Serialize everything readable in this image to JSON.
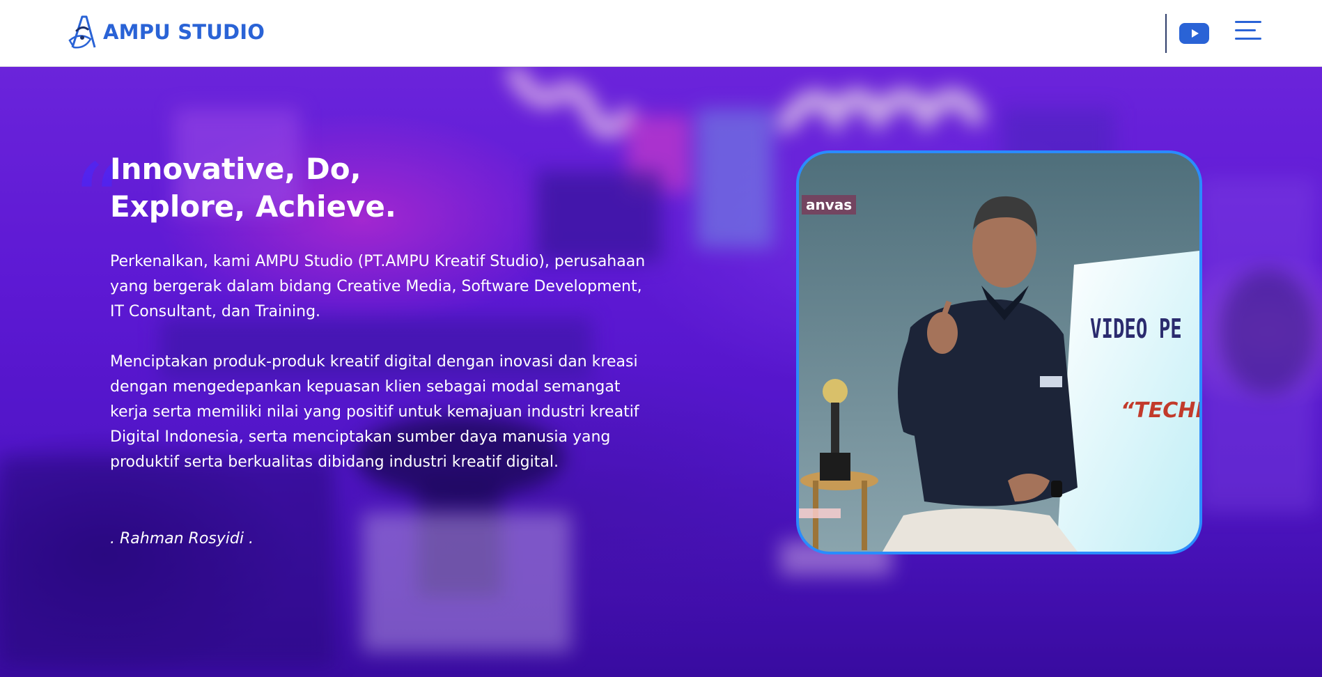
{
  "header": {
    "brand_name": "AMPU STUDIO",
    "icons": {
      "logo": "ampu-studio-logo",
      "youtube": "youtube-play-icon",
      "menu": "hamburger-menu-icon"
    },
    "colors": {
      "brand_blue": "#2a63d6",
      "divider": "#2f3e6b"
    }
  },
  "hero": {
    "quote_mark": "“",
    "title_line1": "Innovative, Do,",
    "title_line2": "Explore, Achieve.",
    "paragraph1": "Perkenalkan, kami AMPU Studio (PT.AMPU Kreatif Studio), perusahaan yang bergerak dalam bidang Creative Media, Software Development, IT Consultant, dan Training.",
    "paragraph2": "Menciptakan produk-produk kreatif digital dengan inovasi dan kreasi dengan mengedepankan kepuasan klien sebagai modal semangat kerja serta memiliki nilai yang positif untuk kemajuan industri kreatif Digital Indonesia, serta menciptakan sumber daya manusia yang produktif serta berkualitas dibidang industri kreatif digital.",
    "signature": ". Rahman Rosyidi .",
    "colors": {
      "overlay_purple": "#6a1fe8",
      "card_border": "#2a8cff"
    }
  },
  "photo": {
    "corner_tag": "anvas",
    "banner_title": "VIDEO PE",
    "banner_subtitle": "“TECHN"
  }
}
